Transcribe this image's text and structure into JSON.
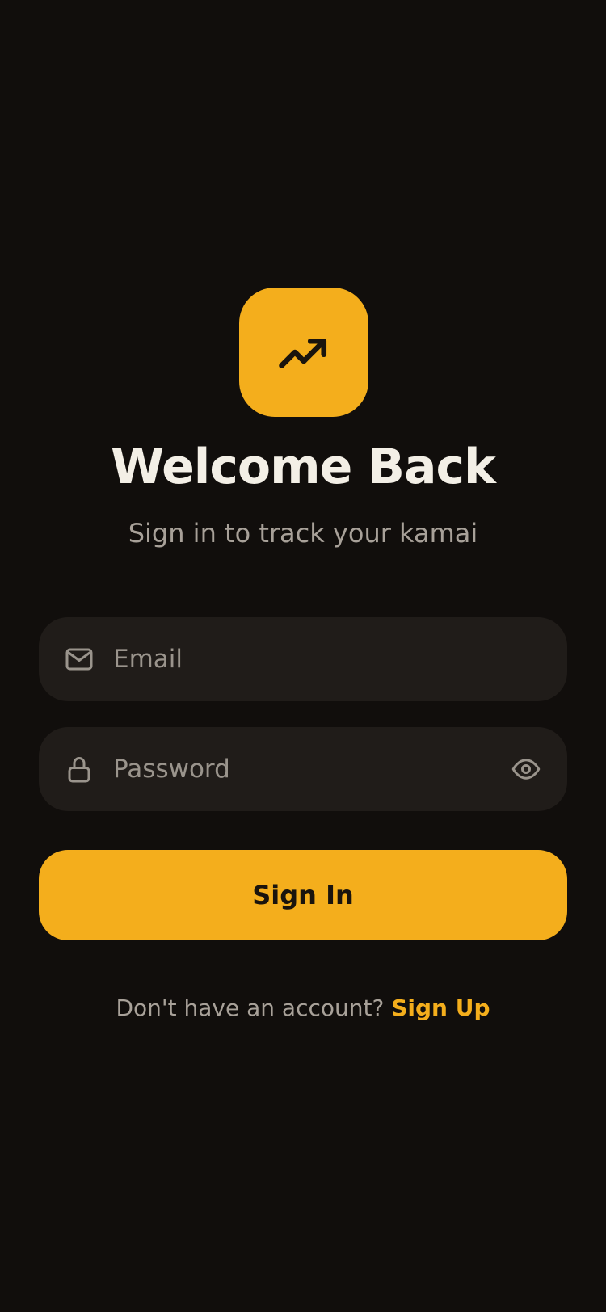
{
  "header": {
    "logo_icon": "trending-up-icon",
    "title": "Welcome Back",
    "subtitle": "Sign in to track your kamai"
  },
  "form": {
    "email": {
      "icon": "mail-icon",
      "placeholder": "Email",
      "value": ""
    },
    "password": {
      "icon": "lock-icon",
      "placeholder": "Password",
      "value": "",
      "toggle_icon": "eye-icon"
    },
    "submit_label": "Sign In"
  },
  "footer": {
    "prompt": "Don't have an account?",
    "link_label": "Sign Up"
  },
  "colors": {
    "background": "#110e0c",
    "accent": "#f4ae1c",
    "field": "#201c19",
    "text": "#f3efe6",
    "muted": "#a8a199"
  }
}
